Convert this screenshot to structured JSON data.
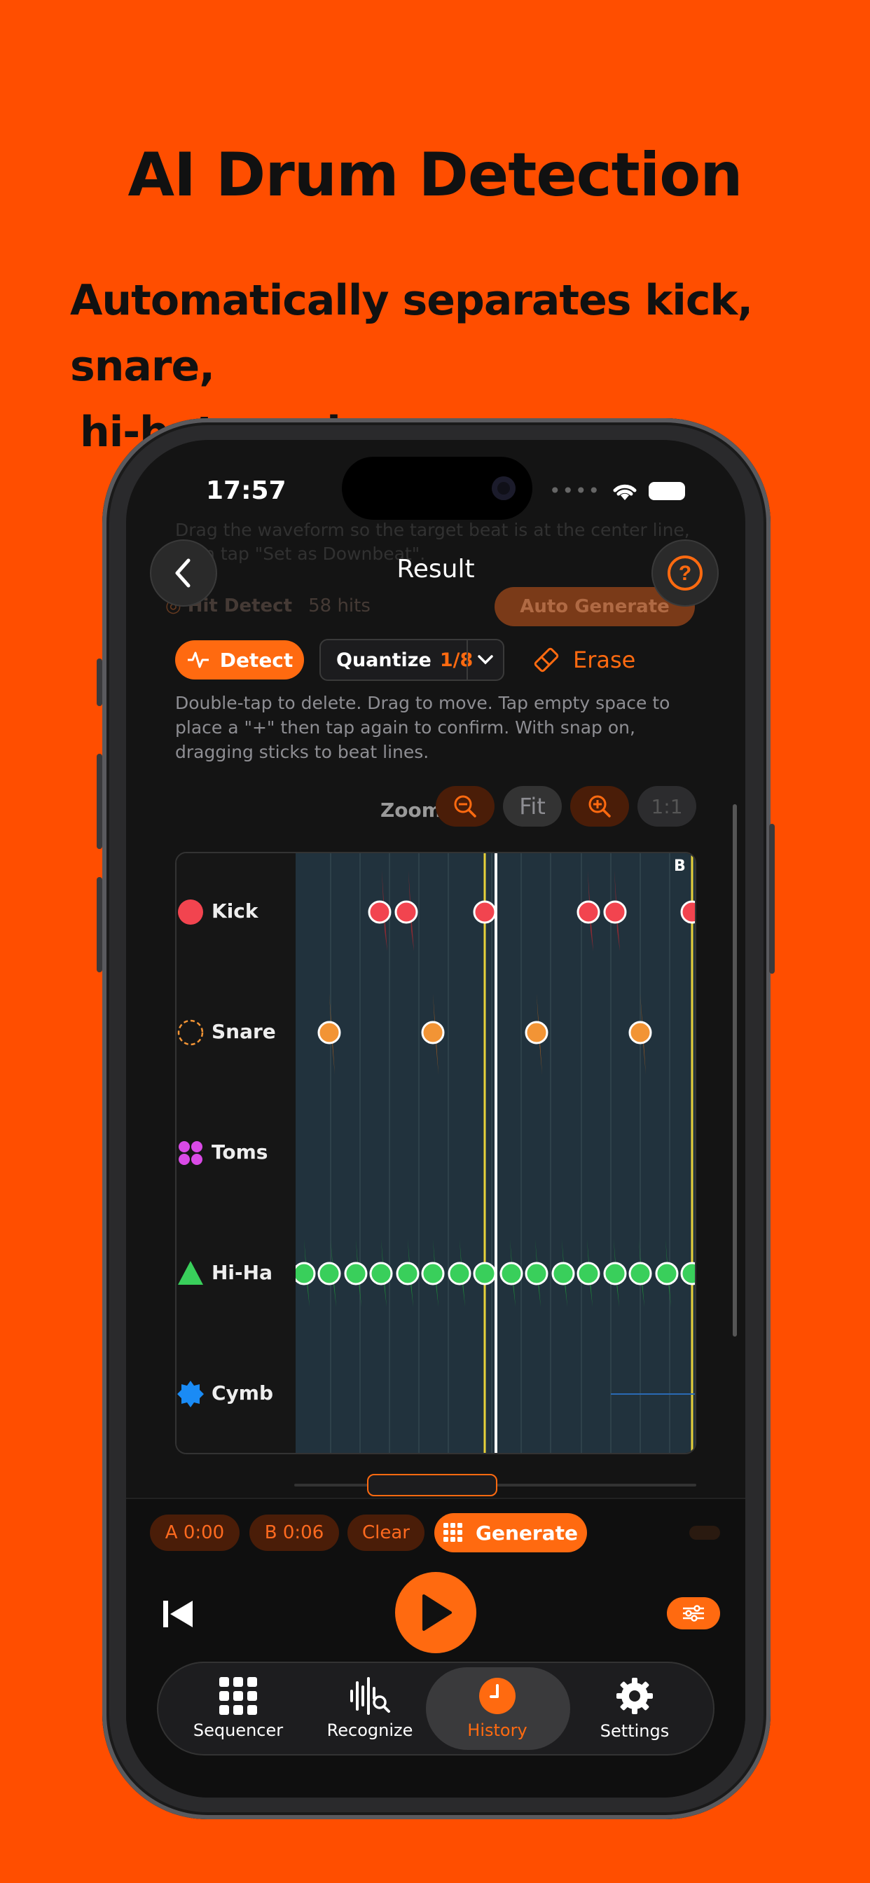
{
  "hero": {
    "title": "AI Drum Detection",
    "subtitle_line1": "Automatically separates kick, snare,",
    "subtitle_line2": "hi-hats and more."
  },
  "status_bar": {
    "time": "17:57",
    "dots": "••••"
  },
  "ghost": {
    "hint": "Drag the waveform so the target beat is at the center line,",
    "hint2": "then tap \"Set as Downbeat\".",
    "hit_detect": "Hit Detect",
    "hits": "58 hits",
    "auto_generate": "Auto Generate"
  },
  "nav": {
    "title": "Result"
  },
  "toolbar": {
    "detect_label": "Detect",
    "quantize_label": "Quantize",
    "quantize_value": "1/8",
    "erase_label": "Erase"
  },
  "help_text": "Double-tap to delete. Drag to move. Tap empty space to place a \"+\" then tap again to confirm. With snap on, dragging sticks to beat lines.",
  "zoom": {
    "label": "Zoom",
    "fit": "Fit",
    "one_to_one": "1:1"
  },
  "lanes": [
    {
      "name": "Kick",
      "color": "#F2444F"
    },
    {
      "name": "Snare",
      "color": "#F29435"
    },
    {
      "name": "Toms",
      "color": "#D94AE6"
    },
    {
      "name": "Hi-Ha",
      "color": "#39CF5B"
    },
    {
      "name": "Cymb",
      "color": "#1A8BF5"
    }
  ],
  "marker_b": "B",
  "loop": {
    "a": "A 0:00",
    "b": "B 0:06",
    "clear": "Clear",
    "generate": "Generate"
  },
  "tabs": [
    {
      "label": "Sequencer",
      "icon": "grid-icon"
    },
    {
      "label": "Recognize",
      "icon": "waveform-search-icon"
    },
    {
      "label": "History",
      "icon": "clock-icon"
    },
    {
      "label": "Settings",
      "icon": "gear-icon"
    }
  ],
  "colors": {
    "accent": "#FF6A10",
    "background": "#FF4E00"
  }
}
